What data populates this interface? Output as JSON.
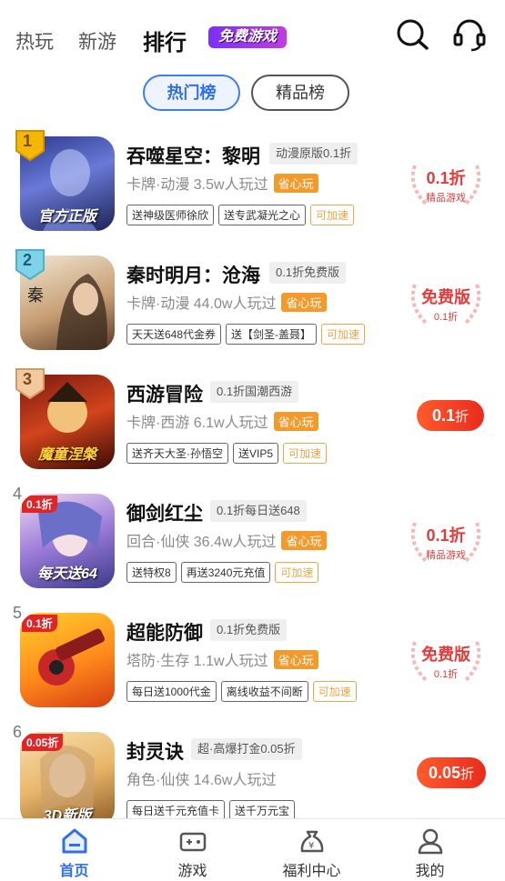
{
  "top_tabs": [
    "热玩",
    "新游",
    "排行"
  ],
  "free_games_badge": "免费游戏",
  "segments": [
    "热门榜",
    "精品榜"
  ],
  "rows": [
    {
      "rank": "1",
      "title": "吞噬星空：黎明",
      "tag": "动漫原版0.1折",
      "meta": "卡牌·动漫  3.5w人玩过",
      "save": "省心玩",
      "chips": [
        "送神级医师徐欣",
        "送专武凝光之心"
      ],
      "accel": "可加速",
      "icon_label": "官方正版",
      "badge": {
        "main": "0.1折",
        "sub": "精品游戏"
      }
    },
    {
      "rank": "2",
      "title": "秦时明月：沧海",
      "tag": "0.1折免费版",
      "meta": "卡牌·动漫  44.0w人玩过",
      "save": "省心玩",
      "chips": [
        "天天送648代金券",
        "送【剑圣-盖聂】"
      ],
      "accel": "可加速",
      "icon_label": "",
      "badge": {
        "main": "免费版",
        "sub": "0.1折"
      }
    },
    {
      "rank": "3",
      "title": "西游冒险",
      "tag": "0.1折国潮西游",
      "meta": "卡牌·西游  6.1w人玩过",
      "save": "省心玩",
      "chips": [
        "送齐天大圣·孙悟空",
        "送VIP5"
      ],
      "accel": "可加速",
      "icon_label": "魔童涅槃",
      "pill": {
        "value": "0.1",
        "unit": "折"
      }
    },
    {
      "rank": "4",
      "title": "御剑红尘",
      "tag": "0.1折每日送648",
      "meta": "回合·仙侠  36.4w人玩过",
      "save": "省心玩",
      "chips": [
        "送特权8",
        "再送3240元充值"
      ],
      "accel": "可加速",
      "icon_label": "每天送64",
      "corner": "0.1折",
      "badge": {
        "main": "0.1折",
        "sub": "精品游戏"
      }
    },
    {
      "rank": "5",
      "title": "超能防御",
      "tag": "0.1折免费版",
      "meta": "塔防·生存  1.1w人玩过",
      "save": "省心玩",
      "chips": [
        "每日送1000代金",
        "离线收益不间断"
      ],
      "accel": "可加速",
      "icon_label": "",
      "corner": "0.1折",
      "badge": {
        "main": "免费版",
        "sub": "0.1折"
      }
    },
    {
      "rank": "6",
      "title": "封灵诀",
      "tag": "超·高爆打金0.05折",
      "meta": "角色·仙侠  14.6w人玩过",
      "save": "",
      "chips": [
        "每日送千元充值卡",
        "送千万元宝"
      ],
      "accel": "",
      "icon_label": "3D新版",
      "corner": "0.05折",
      "pill": {
        "value": "0.05",
        "unit": "折"
      }
    }
  ],
  "bottom_nav": [
    "首页",
    "游戏",
    "福利中心",
    "我的"
  ],
  "colors": {
    "accent": "#2f6fe8",
    "red": "#e53b3b",
    "orange": "#f39a2b"
  }
}
